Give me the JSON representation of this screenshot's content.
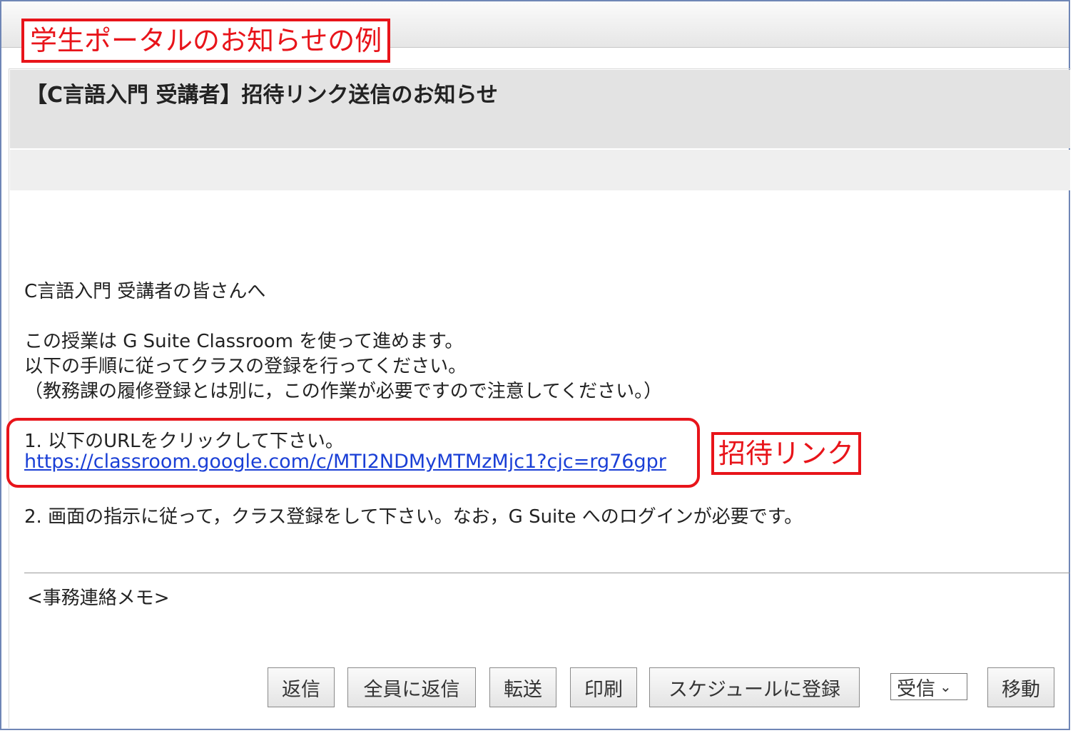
{
  "callouts": {
    "title": "学生ポータルのお知らせの例",
    "link": "招待リンク"
  },
  "message": {
    "subject": "【C言語入門 受講者】招待リンク送信のお知らせ",
    "greeting": "C言語入門 受講者の皆さんへ",
    "line1": "この授業は G Suite Classroom を使って進めます。",
    "line2": "以下の手順に従ってクラスの登録を行ってください。",
    "line3": "（教務課の履修登録とは別に，この作業が必要ですので注意してください。）",
    "step1": "1. 以下のURLをクリックして下さい。",
    "url": "https://classroom.google.com/c/MTI2NDMyMTMzMjc1?cjc=rg76gpr",
    "step2": "2. 画面の指示に従って，クラス登録をして下さい。なお，G Suite へのログインが必要です。",
    "memo": "<事務連絡メモ>"
  },
  "toolbar": {
    "reply": "返信",
    "reply_all": "全員に返信",
    "forward": "転送",
    "print": "印刷",
    "add_schedule": "スケジュールに登録",
    "folder_select": "受信",
    "move": "移動"
  }
}
